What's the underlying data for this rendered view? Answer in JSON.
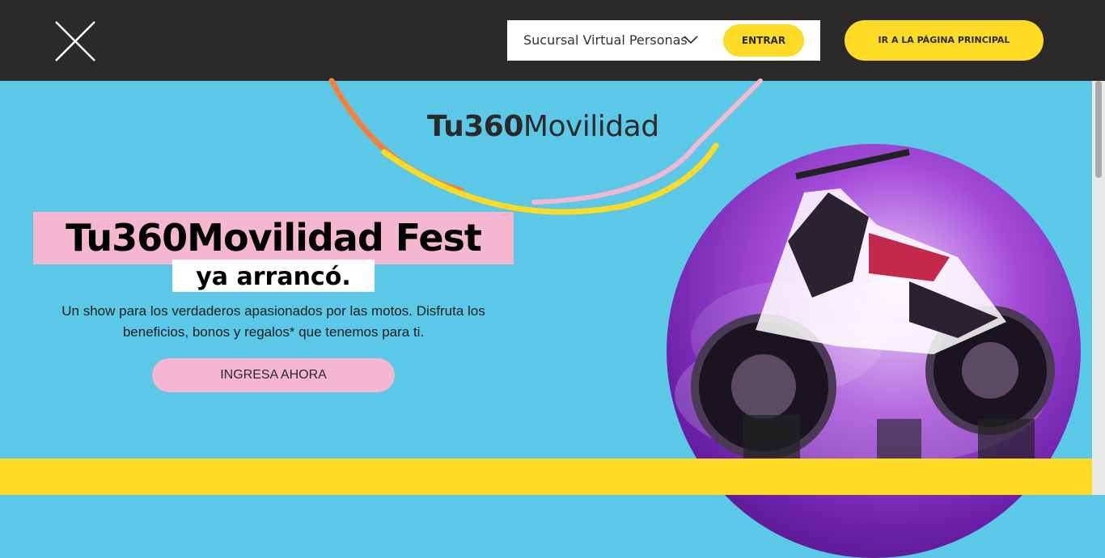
{
  "header": {
    "close_icon": "close-icon",
    "sucursal": {
      "label": "Sucursal Virtual Personas",
      "chevron_icon": "chevron-down-icon",
      "entrar_label": "ENTRAR"
    },
    "home_label": "IR A LA PÁGINA PRINCIPAL"
  },
  "hero": {
    "brand": {
      "bold": "Tu360",
      "regular": "Movilidad"
    },
    "headline_line1": "Tu360Movilidad Fest",
    "headline_line2": "ya arrancó.",
    "description": "Un show para los verdaderos apasionados por las motos. Disfruta los beneficios, bonos y regalos* que tenemos para ti.",
    "cta_label": "INGRESA AHORA",
    "image_icon": "motorcycle-image"
  },
  "colors": {
    "topbar": "#2b2a29",
    "accent_yellow": "#fdda24",
    "hero_blue": "#5bc8e7",
    "pink": "#f5b6d0",
    "orange": "#f7803c"
  }
}
